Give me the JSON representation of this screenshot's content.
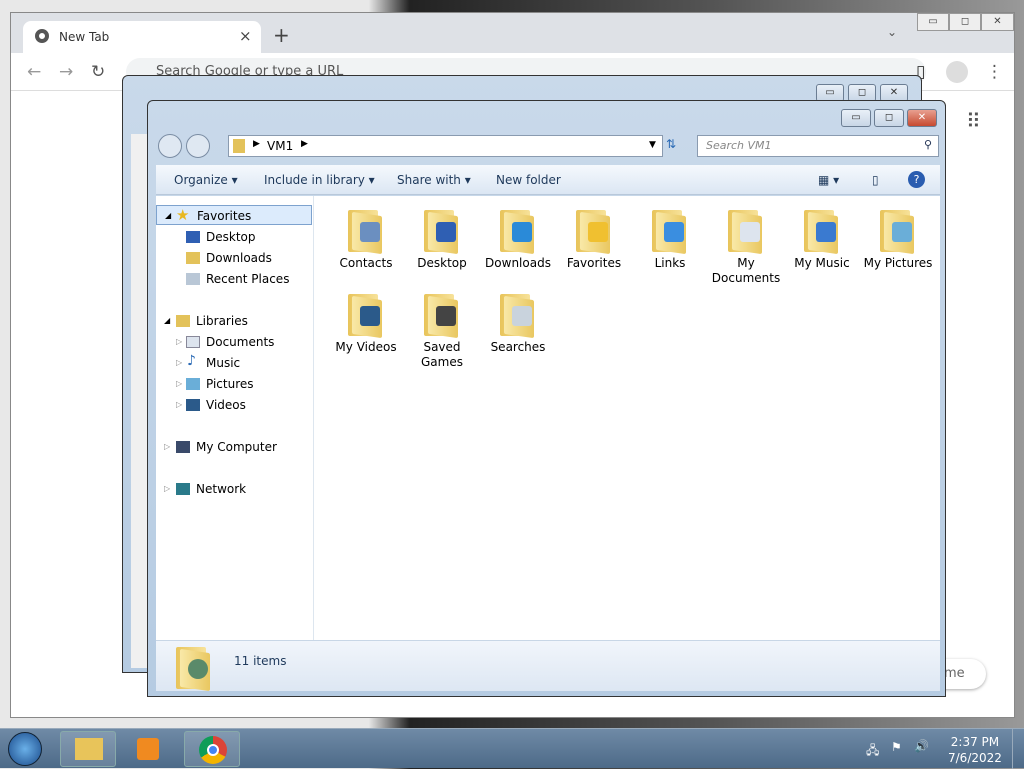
{
  "chrome": {
    "tab_title": "New Tab",
    "omnibox_placeholder": "Search Google or type a URL",
    "bottom_pill": "rome"
  },
  "explorer": {
    "breadcrumb": [
      "VM1"
    ],
    "search_placeholder": "Search VM1",
    "commands": [
      "Organize",
      "Include in library",
      "Share with",
      "New folder"
    ],
    "nav": {
      "favorites": {
        "label": "Favorites",
        "items": [
          "Desktop",
          "Downloads",
          "Recent Places"
        ]
      },
      "libraries": {
        "label": "Libraries",
        "items": [
          "Documents",
          "Music",
          "Pictures",
          "Videos"
        ]
      },
      "computer": "My Computer",
      "network": "Network"
    },
    "folders": [
      {
        "name": "Contacts",
        "emblem": "#6b8fc0"
      },
      {
        "name": "Desktop",
        "emblem": "#2f5fb3"
      },
      {
        "name": "Downloads",
        "emblem": "#2a8ad8"
      },
      {
        "name": "Favorites",
        "emblem": "#f0c030"
      },
      {
        "name": "Links",
        "emblem": "#3a8ee0"
      },
      {
        "name": "My Documents",
        "emblem": "#dde4ee"
      },
      {
        "name": "My Music",
        "emblem": "#3a7ad0"
      },
      {
        "name": "My Pictures",
        "emblem": "#6aaed8"
      },
      {
        "name": "My Videos",
        "emblem": "#2b5a8a"
      },
      {
        "name": "Saved Games",
        "emblem": "#444"
      },
      {
        "name": "Searches",
        "emblem": "#c9d3dd"
      }
    ],
    "status": "11 items"
  },
  "taskbar": {
    "time": "2:37 PM",
    "date": "7/6/2022"
  }
}
